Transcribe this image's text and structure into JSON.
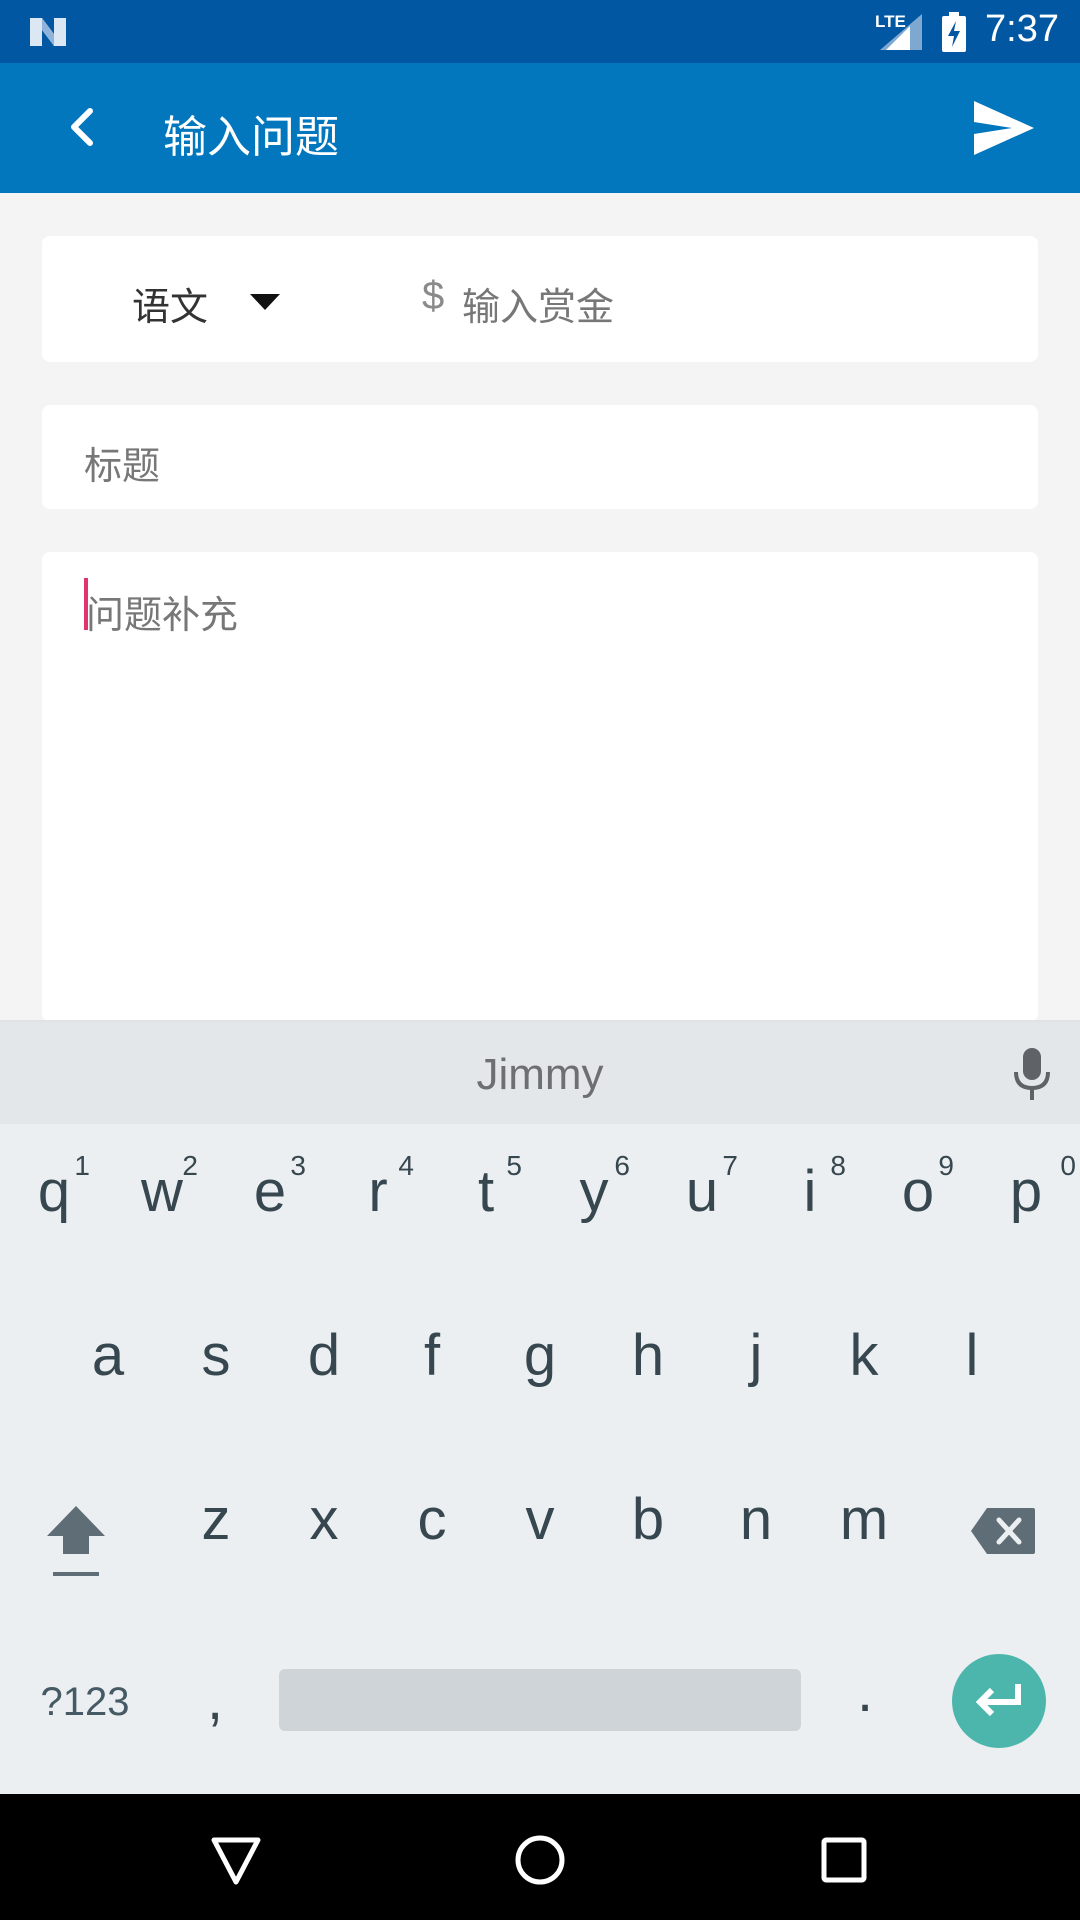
{
  "status_bar": {
    "network": "LTE",
    "time": "7:37"
  },
  "app_bar": {
    "title": "输入问题"
  },
  "form": {
    "subject": "语文",
    "currency_symbol": "$",
    "reward_placeholder": "输入赏金",
    "title_placeholder": "标题",
    "body_placeholder": "问题补充"
  },
  "keyboard": {
    "suggestion": "Jimmy",
    "row1": [
      {
        "letter": "q",
        "hint": "1"
      },
      {
        "letter": "w",
        "hint": "2"
      },
      {
        "letter": "e",
        "hint": "3"
      },
      {
        "letter": "r",
        "hint": "4"
      },
      {
        "letter": "t",
        "hint": "5"
      },
      {
        "letter": "y",
        "hint": "6"
      },
      {
        "letter": "u",
        "hint": "7"
      },
      {
        "letter": "i",
        "hint": "8"
      },
      {
        "letter": "o",
        "hint": "9"
      },
      {
        "letter": "p",
        "hint": "0"
      }
    ],
    "row2": [
      "a",
      "s",
      "d",
      "f",
      "g",
      "h",
      "j",
      "k",
      "l"
    ],
    "row3": [
      "z",
      "x",
      "c",
      "v",
      "b",
      "n",
      "m"
    ],
    "symbols_label": "?123",
    "comma": ",",
    "period": "."
  },
  "colors": {
    "status_bar": "#0157a2",
    "app_bar": "#0277bd",
    "cursor": "#e2356d",
    "enter_key": "#4db6ac"
  },
  "icons": [
    "n-logo-icon",
    "signal-icon",
    "battery-charging-icon",
    "back-arrow-icon",
    "send-icon",
    "dropdown-caret-icon",
    "mic-icon",
    "shift-icon",
    "backspace-icon",
    "enter-icon",
    "nav-back-icon",
    "nav-home-icon",
    "nav-recents-icon"
  ]
}
